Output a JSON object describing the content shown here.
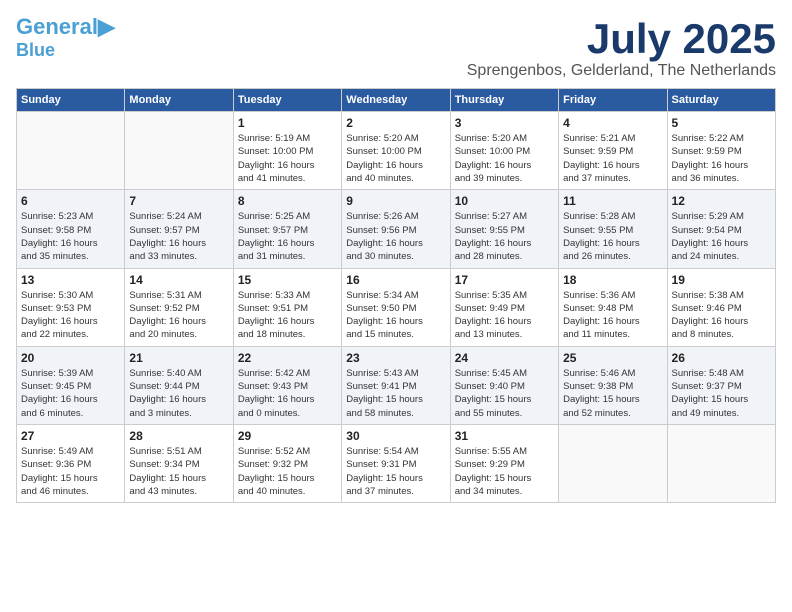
{
  "header": {
    "logo_general": "General",
    "logo_blue": "Blue",
    "month": "July 2025",
    "location": "Sprengenbos, Gelderland, The Netherlands"
  },
  "days_of_week": [
    "Sunday",
    "Monday",
    "Tuesday",
    "Wednesday",
    "Thursday",
    "Friday",
    "Saturday"
  ],
  "weeks": [
    [
      {
        "day": "",
        "detail": ""
      },
      {
        "day": "",
        "detail": ""
      },
      {
        "day": "1",
        "detail": "Sunrise: 5:19 AM\nSunset: 10:00 PM\nDaylight: 16 hours\nand 41 minutes."
      },
      {
        "day": "2",
        "detail": "Sunrise: 5:20 AM\nSunset: 10:00 PM\nDaylight: 16 hours\nand 40 minutes."
      },
      {
        "day": "3",
        "detail": "Sunrise: 5:20 AM\nSunset: 10:00 PM\nDaylight: 16 hours\nand 39 minutes."
      },
      {
        "day": "4",
        "detail": "Sunrise: 5:21 AM\nSunset: 9:59 PM\nDaylight: 16 hours\nand 37 minutes."
      },
      {
        "day": "5",
        "detail": "Sunrise: 5:22 AM\nSunset: 9:59 PM\nDaylight: 16 hours\nand 36 minutes."
      }
    ],
    [
      {
        "day": "6",
        "detail": "Sunrise: 5:23 AM\nSunset: 9:58 PM\nDaylight: 16 hours\nand 35 minutes."
      },
      {
        "day": "7",
        "detail": "Sunrise: 5:24 AM\nSunset: 9:57 PM\nDaylight: 16 hours\nand 33 minutes."
      },
      {
        "day": "8",
        "detail": "Sunrise: 5:25 AM\nSunset: 9:57 PM\nDaylight: 16 hours\nand 31 minutes."
      },
      {
        "day": "9",
        "detail": "Sunrise: 5:26 AM\nSunset: 9:56 PM\nDaylight: 16 hours\nand 30 minutes."
      },
      {
        "day": "10",
        "detail": "Sunrise: 5:27 AM\nSunset: 9:55 PM\nDaylight: 16 hours\nand 28 minutes."
      },
      {
        "day": "11",
        "detail": "Sunrise: 5:28 AM\nSunset: 9:55 PM\nDaylight: 16 hours\nand 26 minutes."
      },
      {
        "day": "12",
        "detail": "Sunrise: 5:29 AM\nSunset: 9:54 PM\nDaylight: 16 hours\nand 24 minutes."
      }
    ],
    [
      {
        "day": "13",
        "detail": "Sunrise: 5:30 AM\nSunset: 9:53 PM\nDaylight: 16 hours\nand 22 minutes."
      },
      {
        "day": "14",
        "detail": "Sunrise: 5:31 AM\nSunset: 9:52 PM\nDaylight: 16 hours\nand 20 minutes."
      },
      {
        "day": "15",
        "detail": "Sunrise: 5:33 AM\nSunset: 9:51 PM\nDaylight: 16 hours\nand 18 minutes."
      },
      {
        "day": "16",
        "detail": "Sunrise: 5:34 AM\nSunset: 9:50 PM\nDaylight: 16 hours\nand 15 minutes."
      },
      {
        "day": "17",
        "detail": "Sunrise: 5:35 AM\nSunset: 9:49 PM\nDaylight: 16 hours\nand 13 minutes."
      },
      {
        "day": "18",
        "detail": "Sunrise: 5:36 AM\nSunset: 9:48 PM\nDaylight: 16 hours\nand 11 minutes."
      },
      {
        "day": "19",
        "detail": "Sunrise: 5:38 AM\nSunset: 9:46 PM\nDaylight: 16 hours\nand 8 minutes."
      }
    ],
    [
      {
        "day": "20",
        "detail": "Sunrise: 5:39 AM\nSunset: 9:45 PM\nDaylight: 16 hours\nand 6 minutes."
      },
      {
        "day": "21",
        "detail": "Sunrise: 5:40 AM\nSunset: 9:44 PM\nDaylight: 16 hours\nand 3 minutes."
      },
      {
        "day": "22",
        "detail": "Sunrise: 5:42 AM\nSunset: 9:43 PM\nDaylight: 16 hours\nand 0 minutes."
      },
      {
        "day": "23",
        "detail": "Sunrise: 5:43 AM\nSunset: 9:41 PM\nDaylight: 15 hours\nand 58 minutes."
      },
      {
        "day": "24",
        "detail": "Sunrise: 5:45 AM\nSunset: 9:40 PM\nDaylight: 15 hours\nand 55 minutes."
      },
      {
        "day": "25",
        "detail": "Sunrise: 5:46 AM\nSunset: 9:38 PM\nDaylight: 15 hours\nand 52 minutes."
      },
      {
        "day": "26",
        "detail": "Sunrise: 5:48 AM\nSunset: 9:37 PM\nDaylight: 15 hours\nand 49 minutes."
      }
    ],
    [
      {
        "day": "27",
        "detail": "Sunrise: 5:49 AM\nSunset: 9:36 PM\nDaylight: 15 hours\nand 46 minutes."
      },
      {
        "day": "28",
        "detail": "Sunrise: 5:51 AM\nSunset: 9:34 PM\nDaylight: 15 hours\nand 43 minutes."
      },
      {
        "day": "29",
        "detail": "Sunrise: 5:52 AM\nSunset: 9:32 PM\nDaylight: 15 hours\nand 40 minutes."
      },
      {
        "day": "30",
        "detail": "Sunrise: 5:54 AM\nSunset: 9:31 PM\nDaylight: 15 hours\nand 37 minutes."
      },
      {
        "day": "31",
        "detail": "Sunrise: 5:55 AM\nSunset: 9:29 PM\nDaylight: 15 hours\nand 34 minutes."
      },
      {
        "day": "",
        "detail": ""
      },
      {
        "day": "",
        "detail": ""
      }
    ]
  ]
}
